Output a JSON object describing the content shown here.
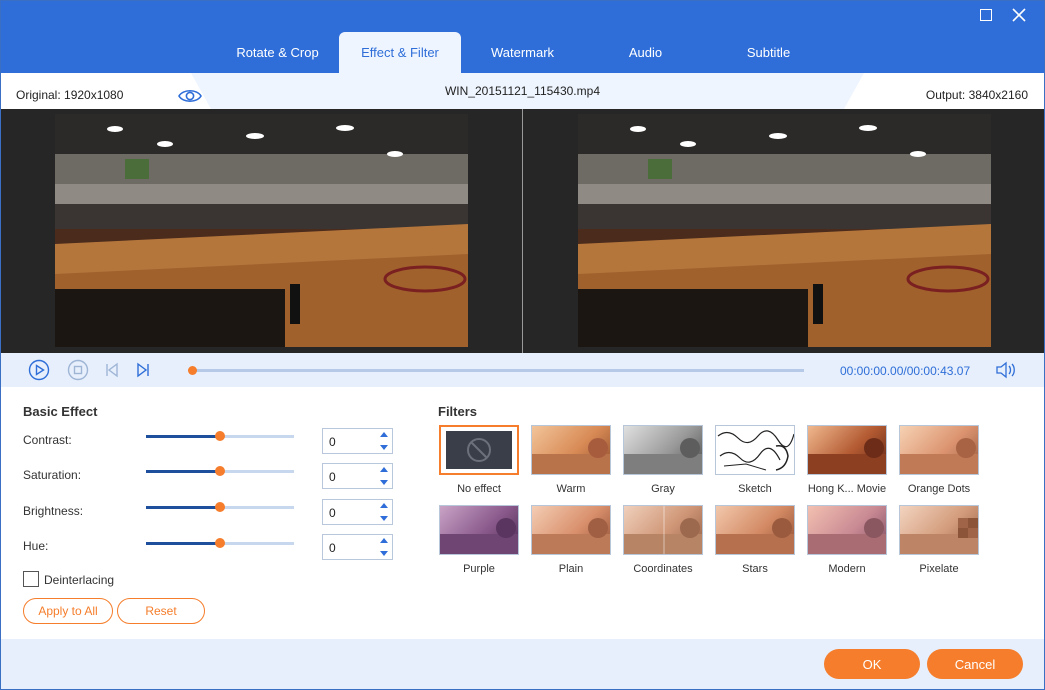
{
  "window": {
    "tabs": [
      {
        "label": "Rotate & Crop"
      },
      {
        "label": "Effect & Filter"
      },
      {
        "label": "Watermark"
      },
      {
        "label": "Audio"
      },
      {
        "label": "Subtitle"
      }
    ],
    "active_tab": "Effect & Filter"
  },
  "info": {
    "original": "Original: 1920x1080",
    "file_name": "WIN_20151121_115430.mp4",
    "output": "Output: 3840x2160"
  },
  "playback": {
    "current_time": "00:00:00.00",
    "total_time": "/00:00:43.07",
    "progress": 0.0
  },
  "basic_effect": {
    "title": "Basic Effect",
    "sliders": [
      {
        "label": "Contrast:",
        "value": "0",
        "level": 0.5
      },
      {
        "label": "Saturation:",
        "value": "0",
        "level": 0.5
      },
      {
        "label": "Brightness:",
        "value": "0",
        "level": 0.5
      },
      {
        "label": "Hue:",
        "value": "0",
        "level": 0.5
      }
    ],
    "deinterlacing_label": "Deinterlacing",
    "deinterlacing_checked": false,
    "apply_to_all": "Apply to All",
    "reset": "Reset"
  },
  "filters": {
    "title": "Filters",
    "items": [
      {
        "label": "No effect",
        "selected": true
      },
      {
        "label": "Warm"
      },
      {
        "label": "Gray"
      },
      {
        "label": "Sketch"
      },
      {
        "label": "Hong K... Movie"
      },
      {
        "label": "Orange Dots"
      },
      {
        "label": "Purple"
      },
      {
        "label": "Plain"
      },
      {
        "label": "Coordinates"
      },
      {
        "label": "Stars"
      },
      {
        "label": "Modern"
      },
      {
        "label": "Pixelate"
      }
    ]
  },
  "footer": {
    "ok": "OK",
    "cancel": "Cancel"
  },
  "colors": {
    "accent": "#2f6ed8",
    "orange": "#f57d2b",
    "light_panel": "#e6effb"
  }
}
